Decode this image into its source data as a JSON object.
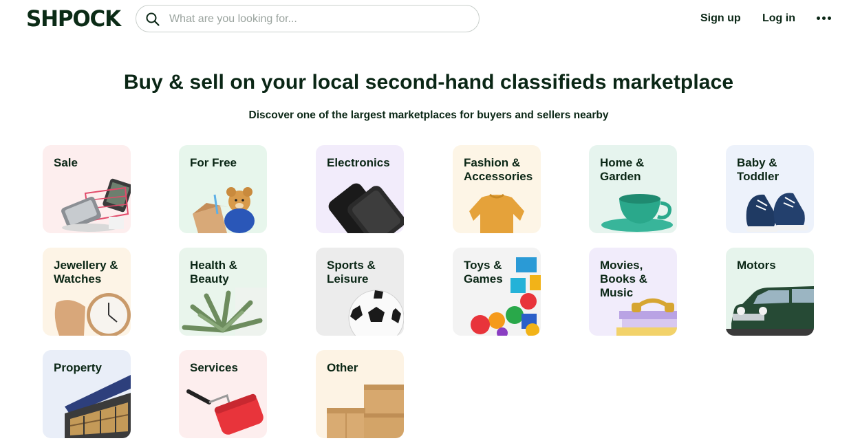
{
  "header": {
    "logo": "SHPOCK",
    "search_placeholder": "What are you looking for...",
    "signup": "Sign up",
    "login": "Log in"
  },
  "hero": {
    "title": "Buy & sell on your local second-hand classifieds marketplace",
    "subtitle": "Discover one of the largest marketplaces for buyers and sellers nearby"
  },
  "categories": [
    {
      "label": "Sale",
      "icon": "shopping-cart-icon",
      "bg": "#fdeeee"
    },
    {
      "label": "For Free",
      "icon": "teddy-bear-icon",
      "bg": "#e7f6ec"
    },
    {
      "label": "Electronics",
      "icon": "smartphones-icon",
      "bg": "#f2ecfb"
    },
    {
      "label": "Fashion & Accessories",
      "icon": "sweater-icon",
      "bg": "#fdf5e6"
    },
    {
      "label": "Home & Garden",
      "icon": "teacup-icon",
      "bg": "#e6f4ee"
    },
    {
      "label": "Baby & Toddler",
      "icon": "baby-shoes-icon",
      "bg": "#edf2fb"
    },
    {
      "label": "Jewellery & Watches",
      "icon": "wristwatch-icon",
      "bg": "#fdf4e6"
    },
    {
      "label": "Health & Beauty",
      "icon": "aloe-plant-icon",
      "bg": "#e9f5ec"
    },
    {
      "label": "Sports & Leisure",
      "icon": "soccer-ball-icon",
      "bg": "#ececec"
    },
    {
      "label": "Toys & Games",
      "icon": "toy-blocks-icon",
      "bg": "#f3f3f3"
    },
    {
      "label": "Movies, Books & Music",
      "icon": "books-headphones-icon",
      "bg": "#f1ecfb"
    },
    {
      "label": "Motors",
      "icon": "car-icon",
      "bg": "#e6f4ec"
    },
    {
      "label": "Property",
      "icon": "building-icon",
      "bg": "#e9eef8"
    },
    {
      "label": "Services",
      "icon": "paint-roller-icon",
      "bg": "#fdeeee"
    },
    {
      "label": "Other",
      "icon": "cardboard-boxes-icon",
      "bg": "#fdf3e4"
    }
  ]
}
